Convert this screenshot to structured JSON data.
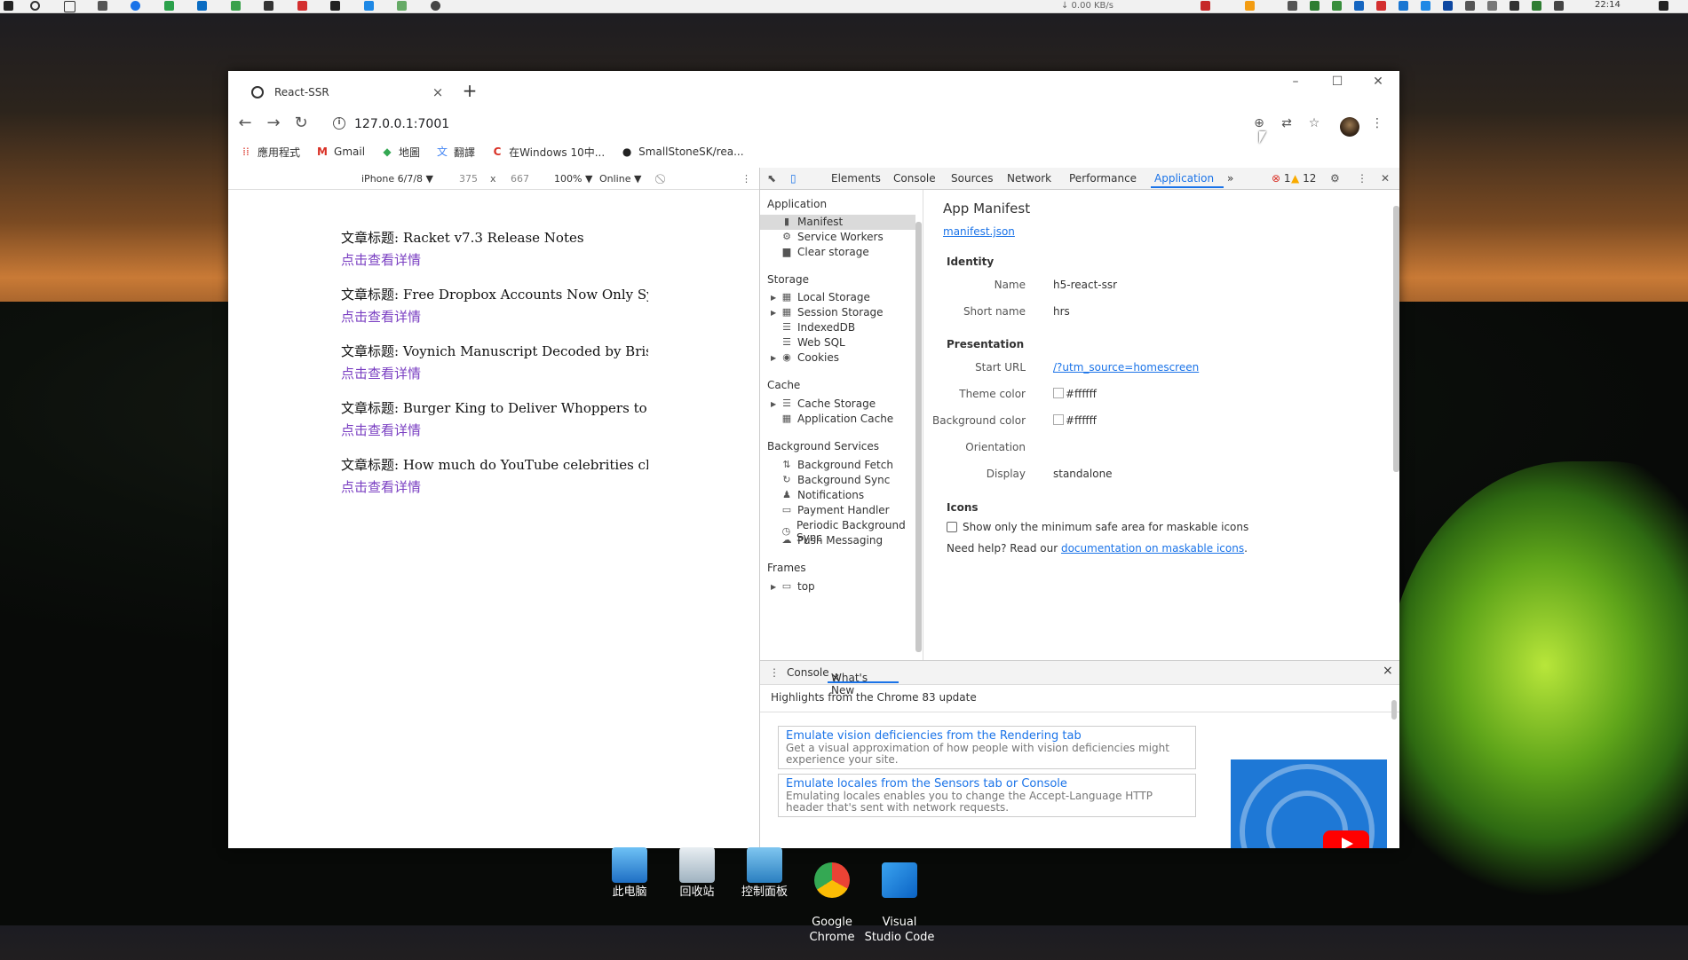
{
  "taskbar": {
    "net_speed": "↓ 0.00 KB/s",
    "clock": "22:14"
  },
  "browser": {
    "tab_title": "React-SSR",
    "url": "127.0.0.1:7001",
    "bookmarks": [
      {
        "label": "應用程式",
        "icon": "apps-icon"
      },
      {
        "label": "Gmail",
        "icon": "gmail-icon"
      },
      {
        "label": "地圖",
        "icon": "maps-icon"
      },
      {
        "label": "翻譯",
        "icon": "translate-icon"
      },
      {
        "label": "在Windows 10中...",
        "icon": "bookmark-red-icon"
      },
      {
        "label": "SmallStoneSK/rea...",
        "icon": "github-icon"
      }
    ]
  },
  "device_toolbar": {
    "device": "iPhone 6/7/8 ▼",
    "width": "375",
    "times": "x",
    "height": "667",
    "zoom": "100% ▼",
    "network": "Online ▼"
  },
  "articles": [
    {
      "title": "文章标题: Racket v7.3 Release Notes",
      "link": "点击查看详情"
    },
    {
      "title": "文章标题: Free Dropbox Accounts Now Only Syn",
      "link": "点击查看详情"
    },
    {
      "title": "文章标题: Voynich Manuscript Decoded by Bristo",
      "link": "点击查看详情"
    },
    {
      "title": "文章标题: Burger King to Deliver Whoppers to LA",
      "link": "点击查看详情"
    },
    {
      "title": "文章标题: How much do YouTube celebrities char",
      "link": "点击查看详情"
    }
  ],
  "devtools": {
    "tabs": [
      "Elements",
      "Console",
      "Sources",
      "Network",
      "Performance",
      "Application"
    ],
    "more": "»",
    "errors": "1",
    "warnings": "12",
    "sidebar": {
      "application": {
        "heading": "Application",
        "items": [
          "Manifest",
          "Service Workers",
          "Clear storage"
        ]
      },
      "storage": {
        "heading": "Storage",
        "items": [
          "Local Storage",
          "Session Storage",
          "IndexedDB",
          "Web SQL",
          "Cookies"
        ]
      },
      "cache": {
        "heading": "Cache",
        "items": [
          "Cache Storage",
          "Application Cache"
        ]
      },
      "background": {
        "heading": "Background Services",
        "items": [
          "Background Fetch",
          "Background Sync",
          "Notifications",
          "Payment Handler",
          "Periodic Background Sync",
          "Push Messaging"
        ]
      },
      "frames": {
        "heading": "Frames",
        "items": [
          "top"
        ]
      }
    },
    "manifest": {
      "title": "App Manifest",
      "link": "manifest.json",
      "identity_heading": "Identity",
      "name_label": "Name",
      "name_value": "h5-react-ssr",
      "short_name_label": "Short name",
      "short_name_value": "hrs",
      "presentation_heading": "Presentation",
      "start_url_label": "Start URL",
      "start_url_value": "/?utm_source=homescreen",
      "theme_color_label": "Theme color",
      "theme_color_value": "#ffffff",
      "bg_color_label": "Background color",
      "bg_color_value": "#ffffff",
      "orientation_label": "Orientation",
      "orientation_value": "",
      "display_label": "Display",
      "display_value": "standalone",
      "icons_heading": "Icons",
      "maskable_checkbox": "Show only the minimum safe area for maskable icons",
      "help_prefix": "Need help? Read our ",
      "help_link": "documentation on maskable icons",
      "help_suffix": "."
    },
    "drawer": {
      "tabs": [
        "Console",
        "What's New"
      ],
      "close": "×",
      "highlights": "Highlights from the Chrome 83 update",
      "cards": [
        {
          "title": "Emulate vision deficiencies from the Rendering tab",
          "desc": "Get a visual approximation of how people with vision deficiencies might experience your site."
        },
        {
          "title": "Emulate locales from the Sensors tab or Console",
          "desc": "Emulating locales enables you to change the Accept-Language HTTP header that's sent with network requests."
        }
      ]
    }
  },
  "desktop_icons": [
    {
      "label": "此电脑"
    },
    {
      "label": "回收站"
    },
    {
      "label": "控制面板"
    },
    {
      "label": "Google\nChrome"
    },
    {
      "label": "Visual\nStudio Code"
    }
  ],
  "colors": {
    "accent": "#1a73e8",
    "visited_link": "#7a3fc2",
    "error": "#d93025",
    "warning": "#f9ab00"
  }
}
